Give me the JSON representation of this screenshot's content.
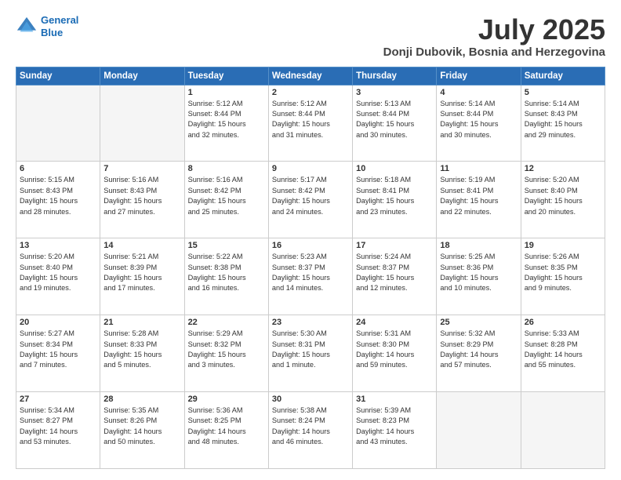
{
  "header": {
    "logo_line1": "General",
    "logo_line2": "Blue",
    "month": "July 2025",
    "location": "Donji Dubovik, Bosnia and Herzegovina"
  },
  "weekdays": [
    "Sunday",
    "Monday",
    "Tuesday",
    "Wednesday",
    "Thursday",
    "Friday",
    "Saturday"
  ],
  "weeks": [
    [
      {
        "day": "",
        "info": ""
      },
      {
        "day": "",
        "info": ""
      },
      {
        "day": "1",
        "info": "Sunrise: 5:12 AM\nSunset: 8:44 PM\nDaylight: 15 hours\nand 32 minutes."
      },
      {
        "day": "2",
        "info": "Sunrise: 5:12 AM\nSunset: 8:44 PM\nDaylight: 15 hours\nand 31 minutes."
      },
      {
        "day": "3",
        "info": "Sunrise: 5:13 AM\nSunset: 8:44 PM\nDaylight: 15 hours\nand 30 minutes."
      },
      {
        "day": "4",
        "info": "Sunrise: 5:14 AM\nSunset: 8:44 PM\nDaylight: 15 hours\nand 30 minutes."
      },
      {
        "day": "5",
        "info": "Sunrise: 5:14 AM\nSunset: 8:43 PM\nDaylight: 15 hours\nand 29 minutes."
      }
    ],
    [
      {
        "day": "6",
        "info": "Sunrise: 5:15 AM\nSunset: 8:43 PM\nDaylight: 15 hours\nand 28 minutes."
      },
      {
        "day": "7",
        "info": "Sunrise: 5:16 AM\nSunset: 8:43 PM\nDaylight: 15 hours\nand 27 minutes."
      },
      {
        "day": "8",
        "info": "Sunrise: 5:16 AM\nSunset: 8:42 PM\nDaylight: 15 hours\nand 25 minutes."
      },
      {
        "day": "9",
        "info": "Sunrise: 5:17 AM\nSunset: 8:42 PM\nDaylight: 15 hours\nand 24 minutes."
      },
      {
        "day": "10",
        "info": "Sunrise: 5:18 AM\nSunset: 8:41 PM\nDaylight: 15 hours\nand 23 minutes."
      },
      {
        "day": "11",
        "info": "Sunrise: 5:19 AM\nSunset: 8:41 PM\nDaylight: 15 hours\nand 22 minutes."
      },
      {
        "day": "12",
        "info": "Sunrise: 5:20 AM\nSunset: 8:40 PM\nDaylight: 15 hours\nand 20 minutes."
      }
    ],
    [
      {
        "day": "13",
        "info": "Sunrise: 5:20 AM\nSunset: 8:40 PM\nDaylight: 15 hours\nand 19 minutes."
      },
      {
        "day": "14",
        "info": "Sunrise: 5:21 AM\nSunset: 8:39 PM\nDaylight: 15 hours\nand 17 minutes."
      },
      {
        "day": "15",
        "info": "Sunrise: 5:22 AM\nSunset: 8:38 PM\nDaylight: 15 hours\nand 16 minutes."
      },
      {
        "day": "16",
        "info": "Sunrise: 5:23 AM\nSunset: 8:37 PM\nDaylight: 15 hours\nand 14 minutes."
      },
      {
        "day": "17",
        "info": "Sunrise: 5:24 AM\nSunset: 8:37 PM\nDaylight: 15 hours\nand 12 minutes."
      },
      {
        "day": "18",
        "info": "Sunrise: 5:25 AM\nSunset: 8:36 PM\nDaylight: 15 hours\nand 10 minutes."
      },
      {
        "day": "19",
        "info": "Sunrise: 5:26 AM\nSunset: 8:35 PM\nDaylight: 15 hours\nand 9 minutes."
      }
    ],
    [
      {
        "day": "20",
        "info": "Sunrise: 5:27 AM\nSunset: 8:34 PM\nDaylight: 15 hours\nand 7 minutes."
      },
      {
        "day": "21",
        "info": "Sunrise: 5:28 AM\nSunset: 8:33 PM\nDaylight: 15 hours\nand 5 minutes."
      },
      {
        "day": "22",
        "info": "Sunrise: 5:29 AM\nSunset: 8:32 PM\nDaylight: 15 hours\nand 3 minutes."
      },
      {
        "day": "23",
        "info": "Sunrise: 5:30 AM\nSunset: 8:31 PM\nDaylight: 15 hours\nand 1 minute."
      },
      {
        "day": "24",
        "info": "Sunrise: 5:31 AM\nSunset: 8:30 PM\nDaylight: 14 hours\nand 59 minutes."
      },
      {
        "day": "25",
        "info": "Sunrise: 5:32 AM\nSunset: 8:29 PM\nDaylight: 14 hours\nand 57 minutes."
      },
      {
        "day": "26",
        "info": "Sunrise: 5:33 AM\nSunset: 8:28 PM\nDaylight: 14 hours\nand 55 minutes."
      }
    ],
    [
      {
        "day": "27",
        "info": "Sunrise: 5:34 AM\nSunset: 8:27 PM\nDaylight: 14 hours\nand 53 minutes."
      },
      {
        "day": "28",
        "info": "Sunrise: 5:35 AM\nSunset: 8:26 PM\nDaylight: 14 hours\nand 50 minutes."
      },
      {
        "day": "29",
        "info": "Sunrise: 5:36 AM\nSunset: 8:25 PM\nDaylight: 14 hours\nand 48 minutes."
      },
      {
        "day": "30",
        "info": "Sunrise: 5:38 AM\nSunset: 8:24 PM\nDaylight: 14 hours\nand 46 minutes."
      },
      {
        "day": "31",
        "info": "Sunrise: 5:39 AM\nSunset: 8:23 PM\nDaylight: 14 hours\nand 43 minutes."
      },
      {
        "day": "",
        "info": ""
      },
      {
        "day": "",
        "info": ""
      }
    ]
  ]
}
